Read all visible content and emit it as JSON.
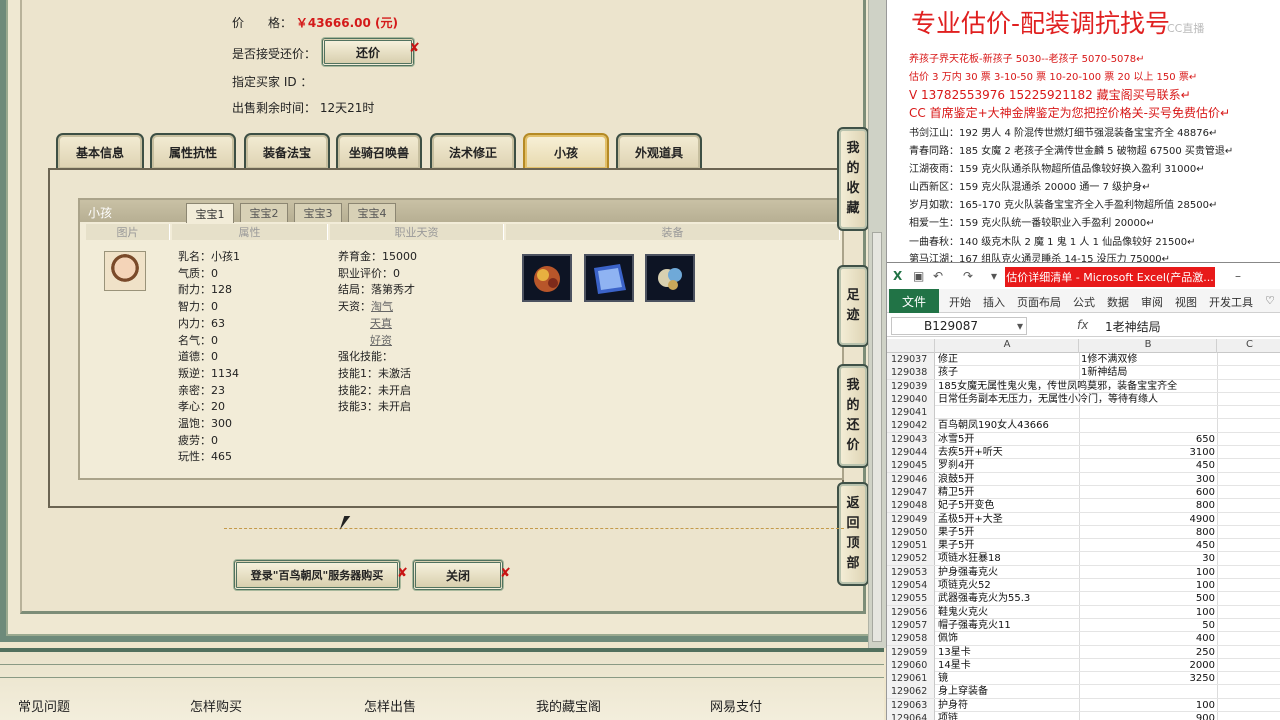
{
  "listing": {
    "price_label": "价　　格：",
    "price_value": "￥43666.00 (元)",
    "counter_offer_label": "是否接受还价：",
    "counter_offer_button": "还价",
    "buyer_id_label": "指定买家 ID ：",
    "time_left_label": "出售剩余时间：",
    "time_left_value": "12天21时"
  },
  "tabs": [
    "基本信息",
    "属性抗性",
    "装备法宝",
    "坐骑召唤兽",
    "法术修正",
    "小孩",
    "外观道具"
  ],
  "child_panel": {
    "title": "小孩",
    "subtabs": [
      "宝宝1",
      "宝宝2",
      "宝宝3",
      "宝宝4"
    ],
    "columns": [
      "图片",
      "属性",
      "职业天资",
      "装备"
    ],
    "stats": [
      "乳名：小孩1",
      "气质：0",
      "耐力：128",
      "智力：0",
      "内力：63",
      "名气：0",
      "道德：0",
      "叛逆：1134",
      "亲密：23",
      "孝心：20",
      "温饱：300",
      "疲劳：0",
      "玩性：465"
    ],
    "career": {
      "raise_fee": "养育金：15000",
      "career_eval": "职业评价：0",
      "ending": "结局：落第秀才",
      "talent_label": "天资：",
      "talents": [
        "淘气",
        "天真",
        "好资"
      ],
      "skill_label": "强化技能：",
      "skills": [
        "技能1：未激活",
        "技能2：未开启",
        "技能3：未开启"
      ]
    }
  },
  "side_buttons": [
    {
      "name": "favorites",
      "text": "我的收藏"
    },
    {
      "name": "footprint",
      "text": "足迹"
    },
    {
      "name": "my-offers",
      "text": "我的还价"
    },
    {
      "name": "back-to-top",
      "text": "返回顶部"
    }
  ],
  "actions": {
    "login_buy": "登录\"百鸟朝凤\"服务器购买",
    "close": "关闭"
  },
  "footer_links": [
    "常见问题",
    "怎样购买",
    "怎样出售",
    "我的藏宝阁",
    "网易支付"
  ],
  "note": {
    "title": "专业估价-配装调抗找号",
    "watermark": "CC直播",
    "lines": [
      "养孩子界天花板-新孩子 5030--老孩子 5070-5078↵",
      "估价 3 万内 30 票   3-10-50 票   10-20-100 票   20 以上 150 票↵",
      "V 13782553976     15225921182    藏宝阁买号联系↵",
      "CC 首席鉴定+大神金牌鉴定为您把控价格关-买号免费估价↵",
      "书剑江山：192 男人 4 阶混传世燃灯细节强混装备宝宝齐全 48876↵",
      "青春同路：185 女魔 2 老孩子全满传世金麟 5 破物超 67500 买贵管退↵",
      "江湖夜雨：159 克火队通杀队物超所值品像较好换入盈利 31000↵",
      "山西新区：159 克火队混通杀 20000 通一 7 级护身↵",
      "岁月如歌：165-170 克火队装备宝宝齐全入手盈利物超所值 28500↵",
      "相爱一生：159 克火队统一番较职业入手盈利 20000↵",
      "一曲春秋：140 级克木队 2 魔 1 鬼 1 人 1 仙品像较好 21500↵",
      "第马江湖：167 组队克火通灵睡杀 14-15 没压力 75000↵"
    ]
  },
  "excel": {
    "title": "估价详细清单 - Microsoft Excel(产品激...",
    "file_tab": "文件",
    "ribbon_tabs": [
      "开始",
      "插入",
      "页面布局",
      "公式",
      "数据",
      "审阅",
      "视图",
      "开发工具"
    ],
    "name_box": "B129087",
    "fx": "fx",
    "formula_value": "1老神结局",
    "columns": [
      "A",
      "B",
      "C"
    ],
    "rows": [
      {
        "n": "129037",
        "a": "修正",
        "b": "1修不满双修",
        "num": ""
      },
      {
        "n": "129038",
        "a": "孩子",
        "b": "1新神结局",
        "num": ""
      },
      {
        "n": "129039",
        "a": "185女魔无属性鬼火鬼，传世凤鸣莫邪，装备宝宝齐全",
        "b": "",
        "num": ""
      },
      {
        "n": "129040",
        "a": "日常任务副本无压力，无属性小冷门，等待有缘人",
        "b": "",
        "num": ""
      },
      {
        "n": "129041",
        "a": "",
        "b": "",
        "num": ""
      },
      {
        "n": "129042",
        "a": "百鸟朝凤190女人43666",
        "b": "",
        "num": ""
      },
      {
        "n": "129043",
        "a": "冰雪5开",
        "b": "",
        "num": "650"
      },
      {
        "n": "129044",
        "a": "去疾5开+听天",
        "b": "",
        "num": "3100"
      },
      {
        "n": "129045",
        "a": "罗刹4开",
        "b": "",
        "num": "450"
      },
      {
        "n": "129046",
        "a": "浪鼓5开",
        "b": "",
        "num": "300"
      },
      {
        "n": "129047",
        "a": "精卫5开",
        "b": "",
        "num": "600"
      },
      {
        "n": "129048",
        "a": "妃子5开变色",
        "b": "",
        "num": "800"
      },
      {
        "n": "129049",
        "a": "孟极5开+大圣",
        "b": "",
        "num": "4900"
      },
      {
        "n": "129050",
        "a": "果子5开",
        "b": "",
        "num": "800"
      },
      {
        "n": "129051",
        "a": "果子5开",
        "b": "",
        "num": "450"
      },
      {
        "n": "129052",
        "a": "项链水狂暴18",
        "b": "",
        "num": "30"
      },
      {
        "n": "129053",
        "a": "护身强毒克火",
        "b": "",
        "num": "100"
      },
      {
        "n": "129054",
        "a": "项链克火52",
        "b": "",
        "num": "100"
      },
      {
        "n": "129055",
        "a": "武器强毒克火为55.3",
        "b": "",
        "num": "500"
      },
      {
        "n": "129056",
        "a": "鞋鬼火克火",
        "b": "",
        "num": "100"
      },
      {
        "n": "129057",
        "a": "帽子强毒克火11",
        "b": "",
        "num": "50"
      },
      {
        "n": "129058",
        "a": "佩饰",
        "b": "",
        "num": "400"
      },
      {
        "n": "129059",
        "a": "13星卡",
        "b": "",
        "num": "250"
      },
      {
        "n": "129060",
        "a": "14星卡",
        "b": "",
        "num": "2000"
      },
      {
        "n": "129061",
        "a": "镜",
        "b": "",
        "num": "3250"
      },
      {
        "n": "129062",
        "a": "身上穿装备",
        "b": "",
        "num": ""
      },
      {
        "n": "129063",
        "a": "护身符",
        "b": "",
        "num": "100"
      },
      {
        "n": "129064",
        "a": "项链",
        "b": "",
        "num": "900"
      }
    ]
  }
}
